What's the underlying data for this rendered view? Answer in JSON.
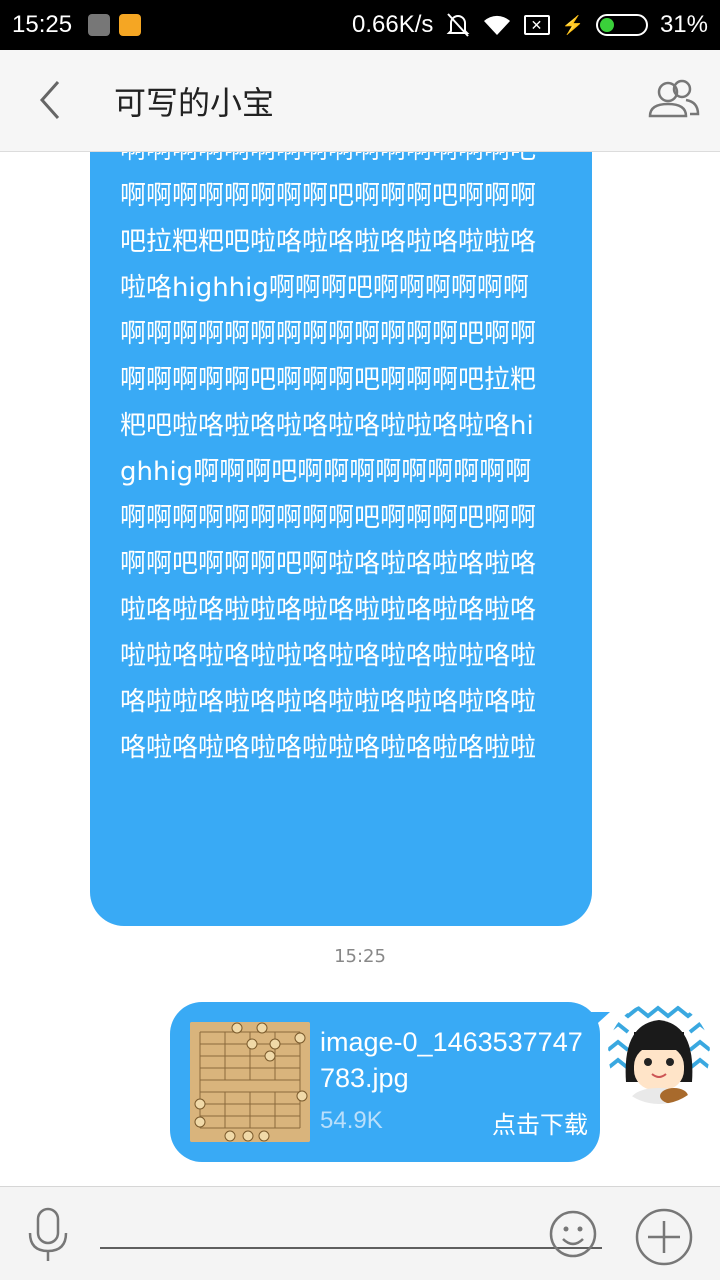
{
  "status_bar": {
    "time": "15:25",
    "network_speed": "0.66K/s",
    "battery_percent": "31%",
    "battery_level": 0.31,
    "sim_label": "✕"
  },
  "header": {
    "title": "可写的小宝"
  },
  "messages": {
    "long_text": "啊啊啊啊啊啊啊啊啊啊啊啊啊啊啊吧啊啊啊啊啊啊啊啊吧啊啊啊吧啊啊啊吧拉粑粑吧啦咯啦咯啦咯啦咯啦啦咯啦咯highhig啊啊啊吧啊啊啊啊啊啊啊啊啊啊啊啊啊啊啊啊啊啊啊吧啊啊啊啊啊啊啊吧啊啊啊吧啊啊啊吧拉粑粑吧啦咯啦咯啦咯啦咯啦啦咯啦咯highhig啊啊啊吧啊啊啊啊啊啊啊啊啊啊啊啊啊啊啊啊啊啊吧啊啊啊吧啊啊啊啊吧啊啊啊吧啊啦咯啦咯啦咯啦咯啦咯啦咯啦啦咯啦咯啦啦咯啦咯啦咯啦啦咯啦咯啦啦咯啦咯啦咯啦啦咯啦咯啦啦咯啦咯啦咯啦啦咯啦咯啦咯啦咯啦咯啦咯啦咯啦啦咯啦咯啦咯啦啦",
    "timestamp": "15:25",
    "file": {
      "name": "image-0_1463537747783.jpg",
      "size": "54.9K",
      "download_label": "点击下载"
    }
  },
  "input": {
    "placeholder": ""
  },
  "colors": {
    "bubble": "#39aaf5",
    "header_bg": "#f6f6f6",
    "battery_fill": "#3ad13a"
  }
}
